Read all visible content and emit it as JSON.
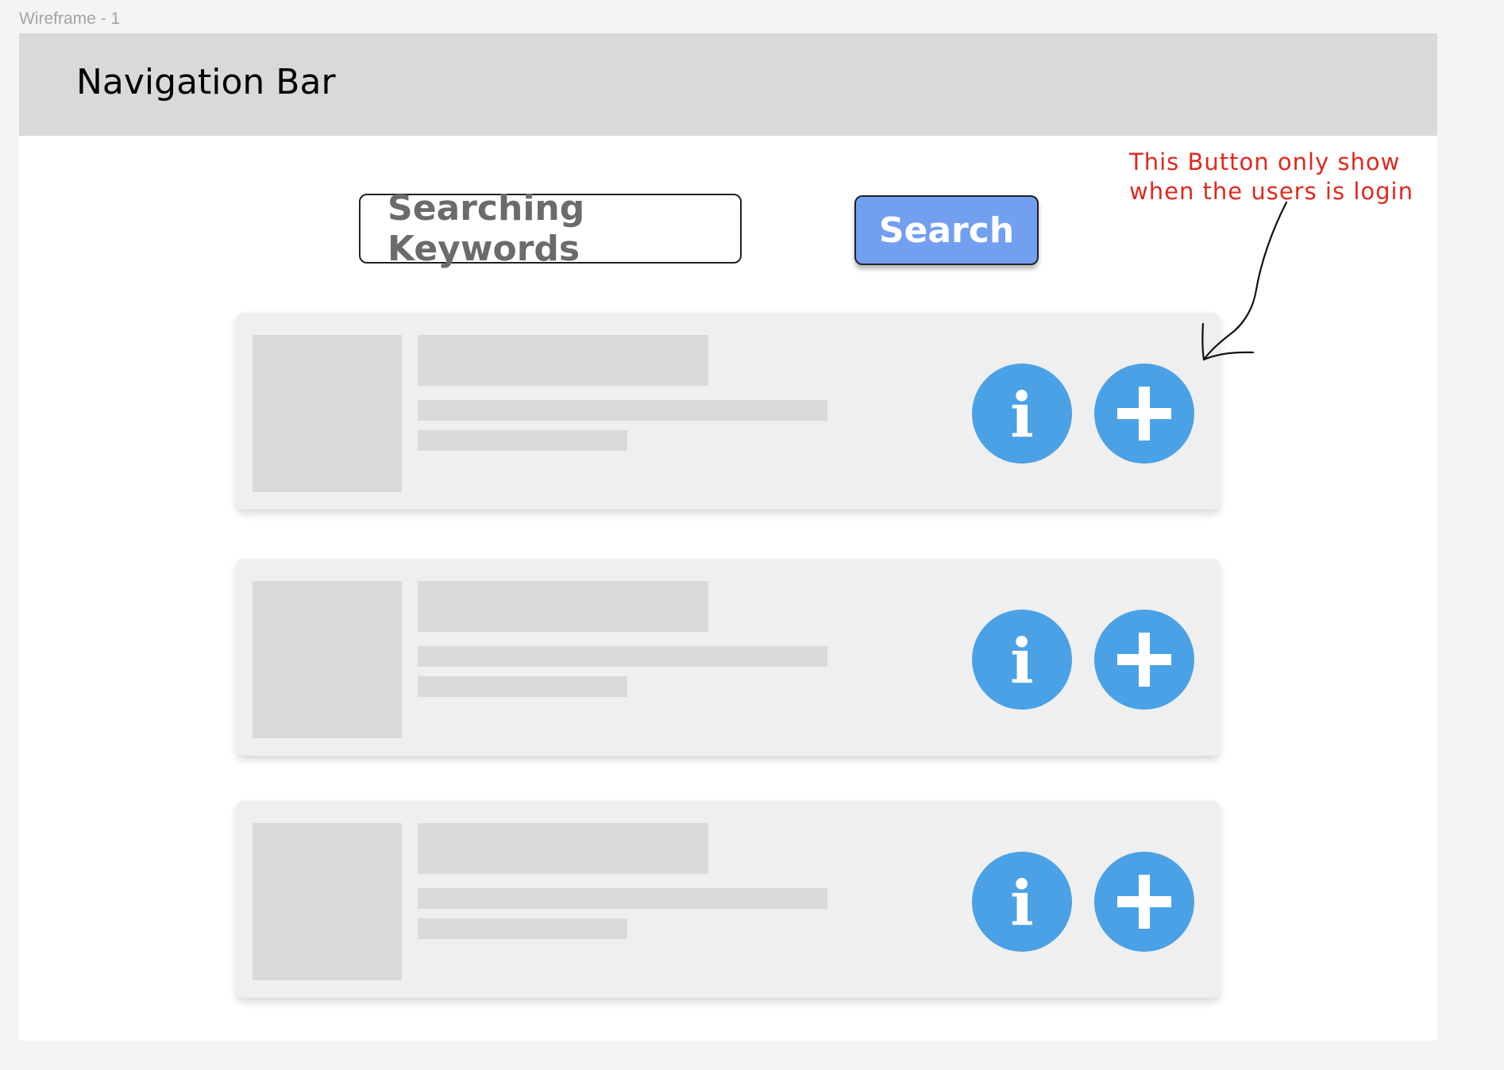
{
  "frame": {
    "label": "Wireframe - 1"
  },
  "navbar": {
    "title": "Navigation Bar"
  },
  "search": {
    "placeholder": "Searching Keywords",
    "button_label": "Search"
  },
  "cards": [
    {
      "info_icon": "info-icon",
      "info_glyph": "i",
      "add_icon": "plus-icon"
    },
    {
      "info_icon": "info-icon",
      "info_glyph": "i",
      "add_icon": "plus-icon"
    },
    {
      "info_icon": "info-icon",
      "info_glyph": "i",
      "add_icon": "plus-icon"
    }
  ],
  "annotation": {
    "line1": "This Button only show",
    "line2": "when the users is login"
  },
  "colors": {
    "navbar_bg": "#d9d9d9",
    "search_button_bg": "#739ff0",
    "round_button_bg": "#4aa1e5",
    "annotation_text": "#e0281e",
    "placeholder_block": "#d9d9d9",
    "card_bg": "#efefef"
  }
}
